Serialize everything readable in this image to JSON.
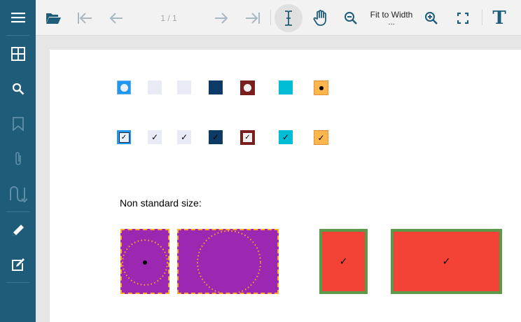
{
  "toolbar": {
    "page_indicator": "1 / 1",
    "zoom_label": "Fit to Width",
    "zoom_more": "...",
    "text_tool_label": "T"
  },
  "icons": {
    "menu": "menu-icon",
    "thumbnails": "thumbnails-icon",
    "search": "search-icon",
    "bookmark": "bookmark-icon",
    "attachment": "paperclip-icon",
    "signature": "signature-icon",
    "annotate": "pencil-icon",
    "edit_form": "edit-form-icon",
    "open": "folder-open-icon",
    "first": "first-page-icon",
    "prev": "previous-page-icon",
    "next": "next-page-icon",
    "last": "last-page-icon",
    "text_select": "text-cursor-icon",
    "pan": "hand-icon",
    "zoom_out": "zoom-out-icon",
    "zoom_in": "zoom-in-icon",
    "fullscreen": "fullscreen-icon"
  },
  "document": {
    "nonstandard_label": "Non standard size:",
    "check_mark": "✓"
  },
  "colors": {
    "sidebar": "#1f5c7a",
    "blue": "#2196f3",
    "lavender": "#e8eaf6",
    "navy": "#0d3b66",
    "maroon": "#7b1e1e",
    "cyan": "#00bcd4",
    "orange": "#ffb74d",
    "purple": "#9c27b0",
    "red": "#f44336",
    "green_border": "#5a9a4a"
  }
}
